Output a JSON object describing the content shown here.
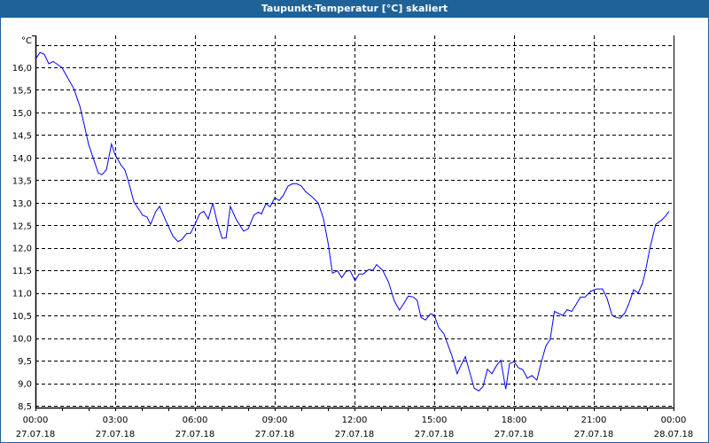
{
  "window": {
    "title": "Taupunkt-Temperatur [°C] skaliert"
  },
  "chart_data": {
    "type": "line",
    "title": "Taupunkt-Temperatur [°C] skaliert",
    "ylabel": "°C",
    "xlabel": "",
    "ylim": [
      8.5,
      16.5
    ],
    "xlim_hours": [
      0,
      24
    ],
    "grid": true,
    "y_ticks": [
      "8,5",
      "9,0",
      "9,5",
      "10,0",
      "10,5",
      "11,0",
      "11,5",
      "12,0",
      "12,5",
      "13,0",
      "13,5",
      "14,0",
      "14,5",
      "15,0",
      "15,5",
      "16,0"
    ],
    "x_ticks": [
      {
        "time": "00:00",
        "date": "27.07.18"
      },
      {
        "time": "03:00",
        "date": "27.07.18"
      },
      {
        "time": "06:00",
        "date": "27.07.18"
      },
      {
        "time": "09:00",
        "date": "27.07.18"
      },
      {
        "time": "12:00",
        "date": "27.07.18"
      },
      {
        "time": "15:00",
        "date": "27.07.18"
      },
      {
        "time": "18:00",
        "date": "27.07.18"
      },
      {
        "time": "21:00",
        "date": "27.07.18"
      },
      {
        "time": "00:00",
        "date": "28.07.18"
      }
    ],
    "series": [
      {
        "name": "Taupunkt",
        "color": "#0000ff",
        "x": [
          0,
          0.17,
          0.33,
          0.5,
          0.67,
          1.0,
          1.22,
          1.44,
          1.67,
          1.83,
          2.0,
          2.17,
          2.36,
          2.5,
          2.67,
          2.86,
          3.0,
          3.22,
          3.36,
          3.5,
          3.7,
          3.94,
          4.02,
          4.2,
          4.33,
          4.53,
          4.67,
          4.89,
          5.17,
          5.36,
          5.5,
          5.69,
          5.83,
          6.0,
          6.17,
          6.33,
          6.5,
          6.67,
          6.83,
          7.02,
          7.17,
          7.33,
          7.56,
          7.83,
          8.0,
          8.22,
          8.39,
          8.5,
          8.67,
          8.83,
          9.0,
          9.17,
          9.33,
          9.5,
          9.67,
          9.83,
          10.0,
          10.17,
          10.39,
          10.64,
          10.83,
          11.0,
          11.17,
          11.36,
          11.52,
          11.67,
          11.83,
          12.02,
          12.17,
          12.33,
          12.53,
          12.69,
          12.83,
          13.06,
          13.28,
          13.5,
          13.69,
          13.87,
          14.02,
          14.22,
          14.36,
          14.5,
          14.67,
          14.86,
          15.0,
          15.17,
          15.36,
          15.67,
          15.86,
          16.0,
          16.17,
          16.5,
          16.67,
          16.83,
          17.0,
          17.17,
          17.33,
          17.5,
          17.69,
          17.83,
          18.0,
          18.17,
          18.33,
          18.5,
          18.67,
          18.86,
          19.02,
          19.2,
          19.36,
          19.52,
          19.67,
          19.83,
          20.0,
          20.17,
          20.33,
          20.5,
          20.67,
          20.89,
          21.11,
          21.33,
          21.5,
          21.69,
          21.83,
          22.0,
          22.17,
          22.33,
          22.5,
          22.67,
          22.83,
          22.94,
          23.11,
          23.33,
          23.56,
          23.72,
          23.83
        ],
        "y": [
          16.18,
          16.33,
          16.29,
          16.08,
          16.13,
          15.99,
          15.76,
          15.53,
          15.14,
          14.74,
          14.29,
          14.0,
          13.66,
          13.62,
          13.73,
          14.3,
          14.06,
          13.83,
          13.73,
          13.47,
          13.02,
          12.81,
          12.73,
          12.68,
          12.52,
          12.81,
          12.92,
          12.62,
          12.26,
          12.14,
          12.18,
          12.32,
          12.32,
          12.52,
          12.75,
          12.81,
          12.64,
          12.99,
          12.58,
          12.21,
          12.22,
          12.92,
          12.62,
          12.37,
          12.42,
          12.73,
          12.79,
          12.75,
          12.98,
          12.91,
          13.11,
          13.05,
          13.17,
          13.37,
          13.42,
          13.42,
          13.37,
          13.24,
          13.14,
          12.99,
          12.65,
          12.13,
          11.44,
          11.49,
          11.34,
          11.47,
          11.5,
          11.27,
          11.42,
          11.42,
          11.52,
          11.5,
          11.63,
          11.5,
          11.24,
          10.82,
          10.62,
          10.78,
          10.93,
          10.91,
          10.83,
          10.46,
          10.4,
          10.54,
          10.51,
          10.23,
          10.1,
          9.6,
          9.21,
          9.39,
          9.59,
          8.89,
          8.83,
          8.92,
          9.31,
          9.21,
          9.38,
          9.51,
          8.87,
          9.43,
          9.48,
          9.34,
          9.3,
          9.11,
          9.17,
          9.07,
          9.46,
          9.83,
          9.97,
          10.59,
          10.55,
          10.5,
          10.63,
          10.59,
          10.74,
          10.91,
          10.91,
          11.04,
          11.09,
          11.09,
          10.88,
          10.5,
          10.46,
          10.44,
          10.56,
          10.78,
          11.07,
          11.0,
          11.21,
          11.47,
          11.99,
          12.52,
          12.62,
          12.72,
          12.81
        ]
      }
    ]
  }
}
